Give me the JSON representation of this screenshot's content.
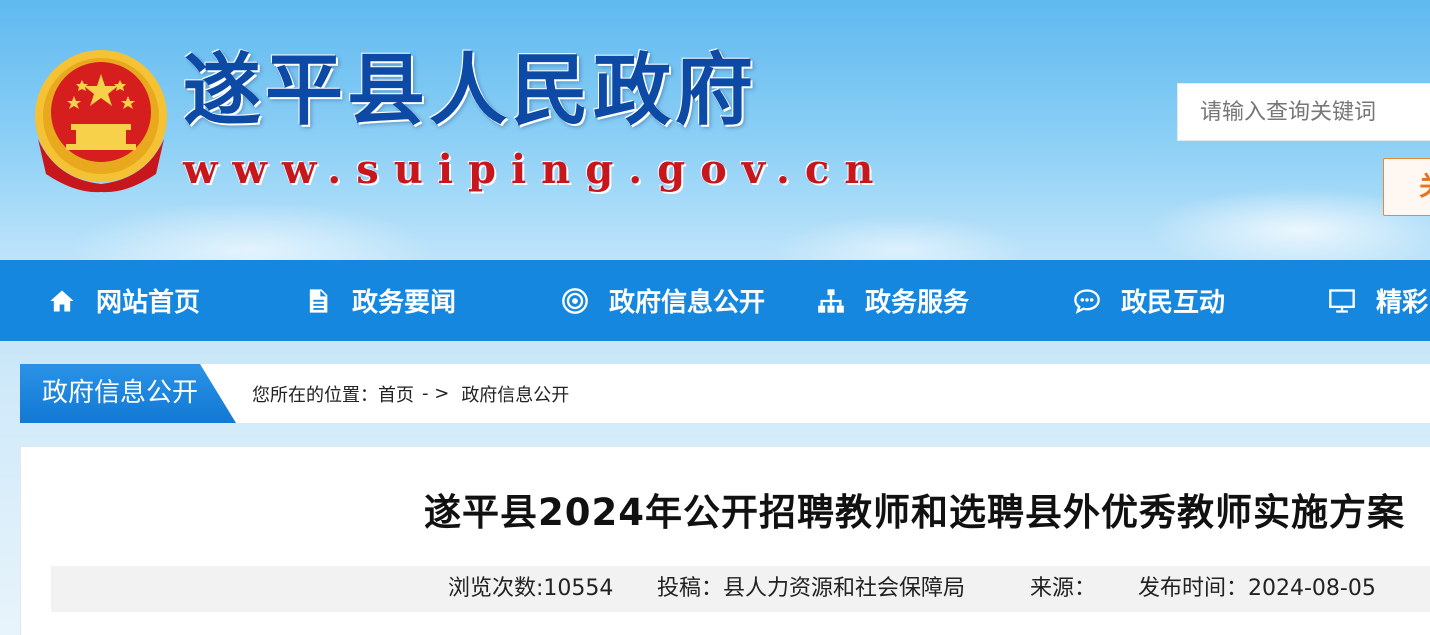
{
  "header": {
    "site_title": "遂平县人民政府",
    "site_url": "www.suiping.gov.cn",
    "search": {
      "placeholder": "请输入查询关键词",
      "button_label": "关"
    }
  },
  "nav": {
    "items": [
      {
        "label": "网站首页",
        "icon": "home-icon"
      },
      {
        "label": "政务要闻",
        "icon": "document-icon"
      },
      {
        "label": "政府信息公开",
        "icon": "target-icon"
      },
      {
        "label": "政务服务",
        "icon": "sitemap-icon"
      },
      {
        "label": "政民互动",
        "icon": "chat-icon"
      },
      {
        "label": "精彩",
        "icon": "monitor-icon"
      }
    ]
  },
  "breadcrumb": {
    "section_tab": "政府信息公开",
    "prefix": "您所在的位置：",
    "home": "首页",
    "separator": "- >",
    "current": "政府信息公开"
  },
  "article": {
    "title": "遂平县2024年公开招聘教师和选聘县外优秀教师实施方案",
    "meta": {
      "views": "浏览次数:10554",
      "contributor": "投稿：县人力资源和社会保障局",
      "source": "来源：",
      "published": "发布时间：2024-08-05"
    }
  },
  "colors": {
    "nav_bg": "#1687df",
    "title_blue": "#0c4aa6",
    "url_red": "#c8161d",
    "search_button": "#e8731c"
  }
}
